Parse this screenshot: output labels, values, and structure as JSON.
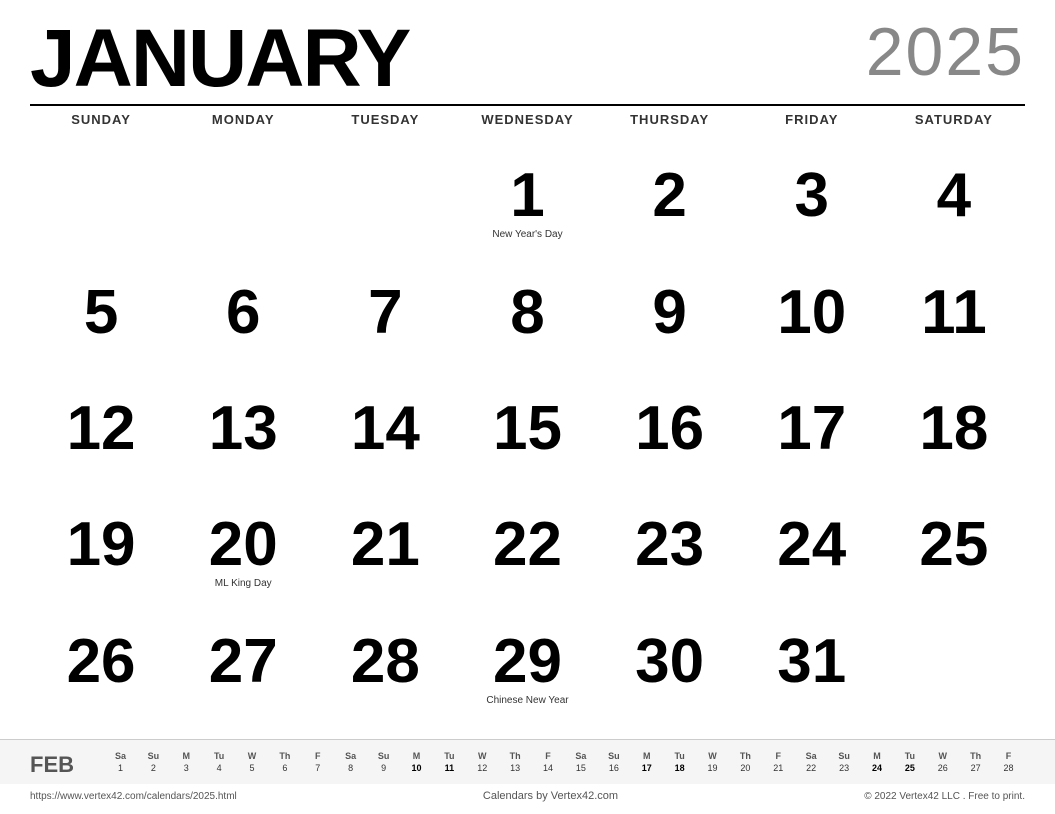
{
  "header": {
    "month": "JANUARY",
    "year": "2025"
  },
  "day_headers": [
    "SUNDAY",
    "MONDAY",
    "TUESDAY",
    "WEDNESDAY",
    "THURSDAY",
    "FRIDAY",
    "SATURDAY"
  ],
  "weeks": [
    [
      {
        "num": "",
        "event": ""
      },
      {
        "num": "",
        "event": ""
      },
      {
        "num": "",
        "event": ""
      },
      {
        "num": "1",
        "event": "New Year's Day"
      },
      {
        "num": "2",
        "event": ""
      },
      {
        "num": "3",
        "event": ""
      },
      {
        "num": "4",
        "event": ""
      }
    ],
    [
      {
        "num": "5",
        "event": ""
      },
      {
        "num": "6",
        "event": ""
      },
      {
        "num": "7",
        "event": ""
      },
      {
        "num": "8",
        "event": ""
      },
      {
        "num": "9",
        "event": ""
      },
      {
        "num": "10",
        "event": ""
      },
      {
        "num": "11",
        "event": ""
      }
    ],
    [
      {
        "num": "12",
        "event": ""
      },
      {
        "num": "13",
        "event": ""
      },
      {
        "num": "14",
        "event": ""
      },
      {
        "num": "15",
        "event": ""
      },
      {
        "num": "16",
        "event": ""
      },
      {
        "num": "17",
        "event": ""
      },
      {
        "num": "18",
        "event": ""
      }
    ],
    [
      {
        "num": "19",
        "event": ""
      },
      {
        "num": "20",
        "event": "ML King Day"
      },
      {
        "num": "21",
        "event": ""
      },
      {
        "num": "22",
        "event": ""
      },
      {
        "num": "23",
        "event": ""
      },
      {
        "num": "24",
        "event": ""
      },
      {
        "num": "25",
        "event": ""
      }
    ],
    [
      {
        "num": "26",
        "event": ""
      },
      {
        "num": "27",
        "event": ""
      },
      {
        "num": "28",
        "event": ""
      },
      {
        "num": "29",
        "event": "Chinese New Year"
      },
      {
        "num": "30",
        "event": ""
      },
      {
        "num": "31",
        "event": ""
      },
      {
        "num": "",
        "event": ""
      }
    ]
  ],
  "mini_calendar": {
    "label": "FEB",
    "headers": [
      "Sa",
      "Su",
      "M",
      "Tu",
      "W",
      "Th",
      "F",
      "Sa",
      "Su",
      "M",
      "Tu",
      "W",
      "Th",
      "F",
      "Sa",
      "Su",
      "M",
      "Tu",
      "W",
      "Th",
      "F",
      "Sa",
      "Su",
      "M",
      "Tu",
      "W",
      "Th",
      "F"
    ],
    "days": [
      "1",
      "2",
      "3",
      "4",
      "5",
      "6",
      "7",
      "8",
      "9",
      "10",
      "11",
      "12",
      "13",
      "14",
      "15",
      "16",
      "17",
      "18",
      "19",
      "20",
      "21",
      "22",
      "23",
      "24",
      "25",
      "26",
      "27",
      "28"
    ]
  },
  "footer": {
    "link": "https://www.vertex42.com/calendars/2025.html",
    "center": "Calendars by Vertex42.com",
    "right": "© 2022 Vertex42 LLC . Free to print."
  }
}
